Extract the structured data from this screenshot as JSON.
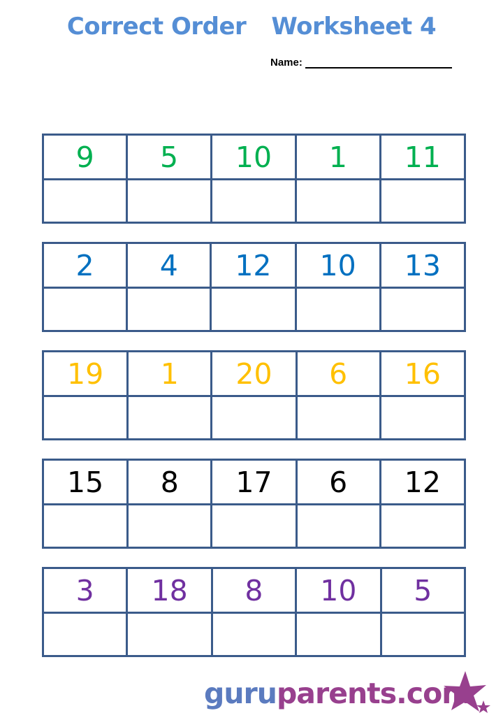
{
  "header": {
    "title_part1": "Correct Order",
    "title_part2": "Worksheet 4",
    "name_label": "Name:"
  },
  "colors": {
    "title": "#558ed5",
    "grid_border": "#3b5b8a",
    "row_colors": [
      "#00b050",
      "#0070c0",
      "#ffc000",
      "#000000",
      "#7030a0"
    ],
    "logo_blue": "#5b7bbf",
    "logo_purple": "#98408e"
  },
  "worksheets": [
    {
      "numbers": [
        "9",
        "5",
        "10",
        "1",
        "11"
      ]
    },
    {
      "numbers": [
        "2",
        "4",
        "12",
        "10",
        "13"
      ]
    },
    {
      "numbers": [
        "19",
        "1",
        "20",
        "6",
        "16"
      ]
    },
    {
      "numbers": [
        "15",
        "8",
        "17",
        "6",
        "12"
      ]
    },
    {
      "numbers": [
        "3",
        "18",
        "8",
        "10",
        "5"
      ]
    }
  ],
  "footer": {
    "logo_part1": "guru",
    "logo_part2": "parents.com",
    "icon": "star-icon"
  }
}
